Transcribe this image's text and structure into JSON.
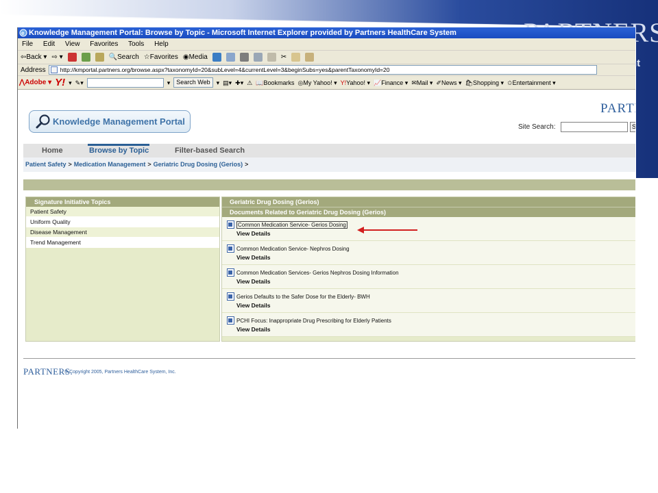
{
  "banner": {
    "logo_text": "PARTNERS",
    "sub_text": "nt"
  },
  "window": {
    "title": "Knowledge Management Portal: Browse by Topic - Microsoft Internet Explorer provided by Partners HealthCare System",
    "menu": [
      "File",
      "Edit",
      "View",
      "Favorites",
      "Tools",
      "Help"
    ],
    "toolbar": {
      "back": "Back",
      "search": "Search",
      "favorites": "Favorites",
      "media": "Media"
    },
    "address": {
      "label": "Address",
      "url": "http://kmportal.partners.org/browse.aspx?taxonomyId=20&subLevel=4&currentLevel=3&beginSubs=yes&parentTaxonomyId=20"
    },
    "yahoo_bar": {
      "adobe": "Adobe",
      "yahoo": "Y!",
      "search_button": "Search Web",
      "items": [
        "Bookmarks",
        "My Yahoo!",
        "Yahoo!",
        "Finance",
        "Mail",
        "News",
        "Shopping",
        "Entertainment"
      ]
    }
  },
  "portal": {
    "logo_text": "Knowledge Management Portal",
    "partners_text": "PARTNE",
    "site_search_label": "Site Search:",
    "site_search_button": "S",
    "nav": {
      "home": "Home",
      "browse": "Browse by Topic",
      "filter": "Filter-based Search"
    },
    "breadcrumb": [
      "Patient Safety",
      "Medication Management",
      "Geriatric Drug Dosing (Gerios)"
    ],
    "breadcrumb_sep": ">",
    "left": {
      "header": "Signature Initiative Topics",
      "items": [
        "Patient Safety",
        "Uniform Quality",
        "Disease Management",
        "Trend Management"
      ]
    },
    "right": {
      "header1": "Geriatric Drug Dosing (Gerios)",
      "header2": "Documents Related to Geriatric Drug Dosing (Gerios)",
      "view_details": "View Details",
      "documents": [
        "Common Medication Service- Gerios Dosing",
        "Common Medication Service- Nephros Dosing",
        "Common Medication Services- Gerios Nephros Dosing Information",
        "Gerios Defaults to the Safer Dose for the Elderly- BWH",
        "PCHI Focus: Inappropriate Drug Prescribing for Elderly Patients"
      ]
    },
    "footer": {
      "logo": "PARTNERS.",
      "copyright": "© Copyright 2005, Partners HealthCare System, Inc."
    }
  },
  "colors": {
    "accent_blue": "#2b5f95",
    "olive": "#a3a97c",
    "arrow_red": "#d21f1f",
    "banner_blue": "#1e3f8f"
  }
}
